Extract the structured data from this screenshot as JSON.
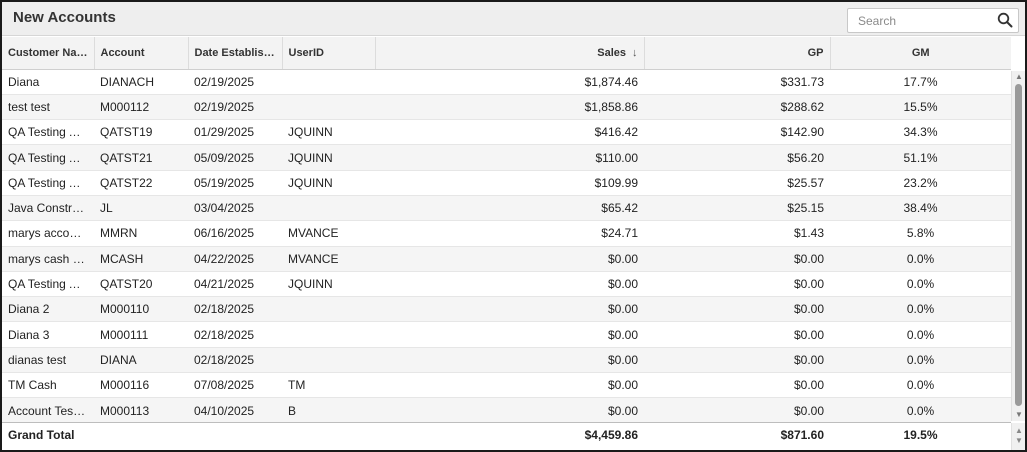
{
  "header": {
    "title": "New Accounts",
    "search_placeholder": "Search"
  },
  "columns": {
    "customer": "Customer Na…",
    "account": "Account",
    "date": "Date Establish…",
    "userid": "UserID",
    "sales": "Sales",
    "sales_sort": "↓",
    "gp": "GP",
    "gm": "GM"
  },
  "rows": [
    {
      "customer": "Diana",
      "account": "DIANACH",
      "date": "02/19/2025",
      "userid": "",
      "sales": "$1,874.46",
      "gp": "$331.73",
      "gm": "17.7%"
    },
    {
      "customer": "test test",
      "account": "M000112",
      "date": "02/19/2025",
      "userid": "",
      "sales": "$1,858.86",
      "gp": "$288.62",
      "gm": "15.5%"
    },
    {
      "customer": "QA Testing A…",
      "account": "QATST19",
      "date": "01/29/2025",
      "userid": "JQUINN",
      "sales": "$416.42",
      "gp": "$142.90",
      "gm": "34.3%"
    },
    {
      "customer": "QA Testing A…",
      "account": "QATST21",
      "date": "05/09/2025",
      "userid": "JQUINN",
      "sales": "$110.00",
      "gp": "$56.20",
      "gm": "51.1%"
    },
    {
      "customer": "QA Testing A…",
      "account": "QATST22",
      "date": "05/19/2025",
      "userid": "JQUINN",
      "sales": "$109.99",
      "gp": "$25.57",
      "gm": "23.2%"
    },
    {
      "customer": "Java Constru…",
      "account": "JL",
      "date": "03/04/2025",
      "userid": "",
      "sales": "$65.42",
      "gp": "$25.15",
      "gm": "38.4%"
    },
    {
      "customer": "marys accou…",
      "account": "MMRN",
      "date": "06/16/2025",
      "userid": "MVANCE",
      "sales": "$24.71",
      "gp": "$1.43",
      "gm": "5.8%"
    },
    {
      "customer": "marys cash a…",
      "account": "MCASH",
      "date": "04/22/2025",
      "userid": "MVANCE",
      "sales": "$0.00",
      "gp": "$0.00",
      "gm": "0.0%"
    },
    {
      "customer": "QA Testing A…",
      "account": "QATST20",
      "date": "04/21/2025",
      "userid": "JQUINN",
      "sales": "$0.00",
      "gp": "$0.00",
      "gm": "0.0%"
    },
    {
      "customer": "Diana 2",
      "account": "M000110",
      "date": "02/18/2025",
      "userid": "",
      "sales": "$0.00",
      "gp": "$0.00",
      "gm": "0.0%"
    },
    {
      "customer": "Diana 3",
      "account": "M000111",
      "date": "02/18/2025",
      "userid": "",
      "sales": "$0.00",
      "gp": "$0.00",
      "gm": "0.0%"
    },
    {
      "customer": "dianas test",
      "account": "DIANA",
      "date": "02/18/2025",
      "userid": "",
      "sales": "$0.00",
      "gp": "$0.00",
      "gm": "0.0%"
    },
    {
      "customer": "TM Cash",
      "account": "M000116",
      "date": "07/08/2025",
      "userid": "TM",
      "sales": "$0.00",
      "gp": "$0.00",
      "gm": "0.0%"
    },
    {
      "customer": "Account Test…",
      "account": "M000113",
      "date": "04/10/2025",
      "userid": "B",
      "sales": "$0.00",
      "gp": "$0.00",
      "gm": "0.0%"
    }
  ],
  "totals": {
    "label": "Grand Total",
    "sales": "$4,459.86",
    "gp": "$871.60",
    "gm": "19.5%"
  },
  "icons": {
    "search": "search-icon",
    "scroll_up": "scroll-up-icon",
    "scroll_down": "scroll-down-icon"
  }
}
